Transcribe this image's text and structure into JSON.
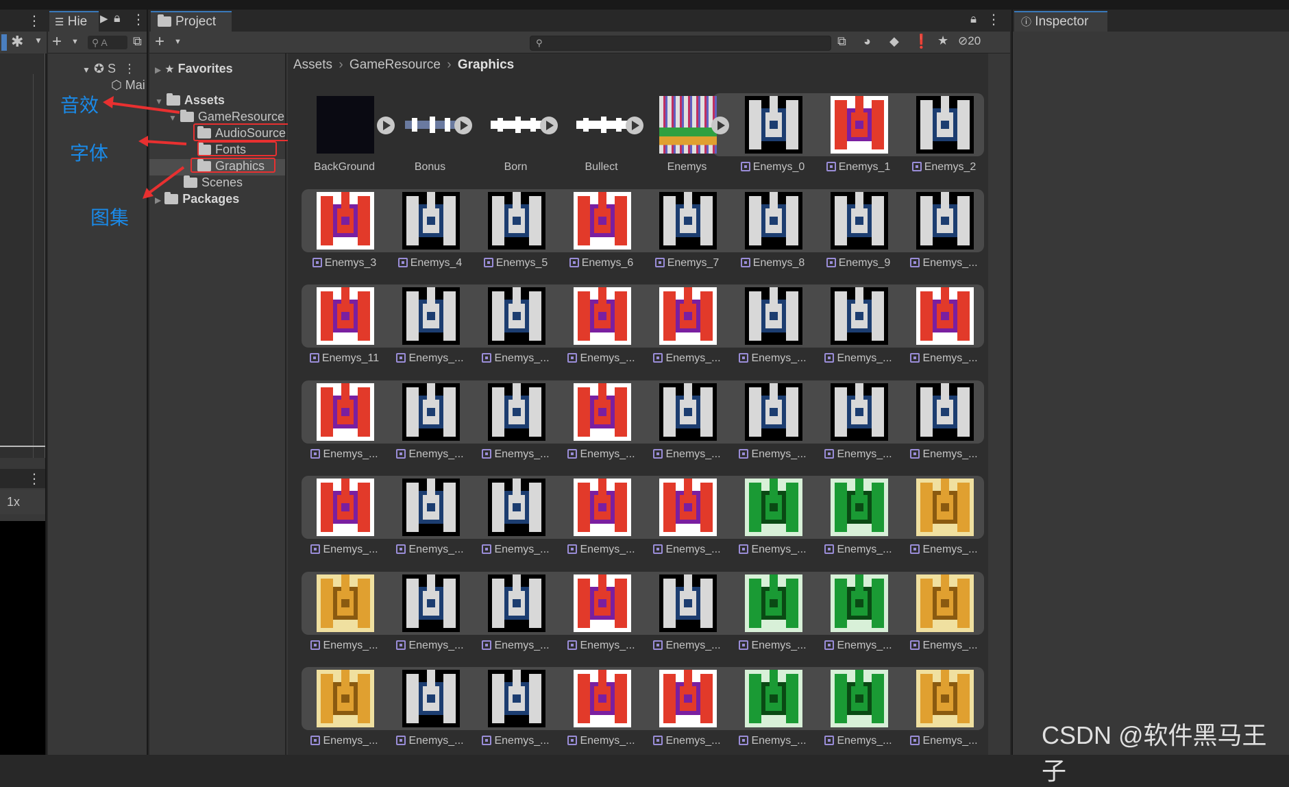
{
  "hierarchy": {
    "tab_label": "Hie",
    "search_placeholder": "A",
    "scene_label": "S",
    "camera_label": "Mai",
    "zoom": "1x"
  },
  "project": {
    "tab_label": "Project",
    "search_placeholder": "",
    "hidden_count": "20",
    "tree": {
      "favorites": "Favorites",
      "assets": "Assets",
      "game_resource": "GameResource",
      "audio_source": "AudioSource",
      "fonts": "Fonts",
      "graphics": "Graphics",
      "scenes": "Scenes",
      "packages": "Packages"
    },
    "breadcrumb": [
      "Assets",
      "GameResource",
      "Graphics"
    ],
    "assets": [
      "BackGround",
      "Bonus",
      "Born",
      "Bullect",
      "Enemys",
      "Enemys_0",
      "Enemys_1",
      "Enemys_2",
      "Enemys_3",
      "Enemys_4",
      "Enemys_5",
      "Enemys_6",
      "Enemys_7",
      "Enemys_8",
      "Enemys_9",
      "Enemys_...",
      "Enemys_11",
      "Enemys_...",
      "Enemys_...",
      "Enemys_...",
      "Enemys_...",
      "Enemys_...",
      "Enemys_...",
      "Enemys_...",
      "Enemys_...",
      "Enemys_...",
      "Enemys_...",
      "Enemys_...",
      "Enemys_...",
      "Enemys_...",
      "Enemys_...",
      "Enemys_...",
      "Enemys_...",
      "Enemys_...",
      "Enemys_...",
      "Enemys_...",
      "Enemys_...",
      "Enemys_...",
      "Enemys_...",
      "Enemys_...",
      "Enemys_...",
      "Enemys_...",
      "Enemys_...",
      "Enemys_...",
      "Enemys_...",
      "Enemys_...",
      "Enemys_...",
      "Enemys_...",
      "Enemys_...",
      "Enemys_...",
      "Enemys_...",
      "Enemys_...",
      "Enemys_...",
      "Enemys_...",
      "Enemys_...",
      "Enemys_..."
    ]
  },
  "inspector": {
    "tab_label": "Inspector"
  },
  "annotations": {
    "audio": "音效",
    "font": "字体",
    "atlas": "图集"
  },
  "watermark": "CSDN @软件黑马王子",
  "colors": {
    "accent": "#3a79bb",
    "annotation": "#1a8ae8",
    "highlight_box": "#e83030"
  }
}
